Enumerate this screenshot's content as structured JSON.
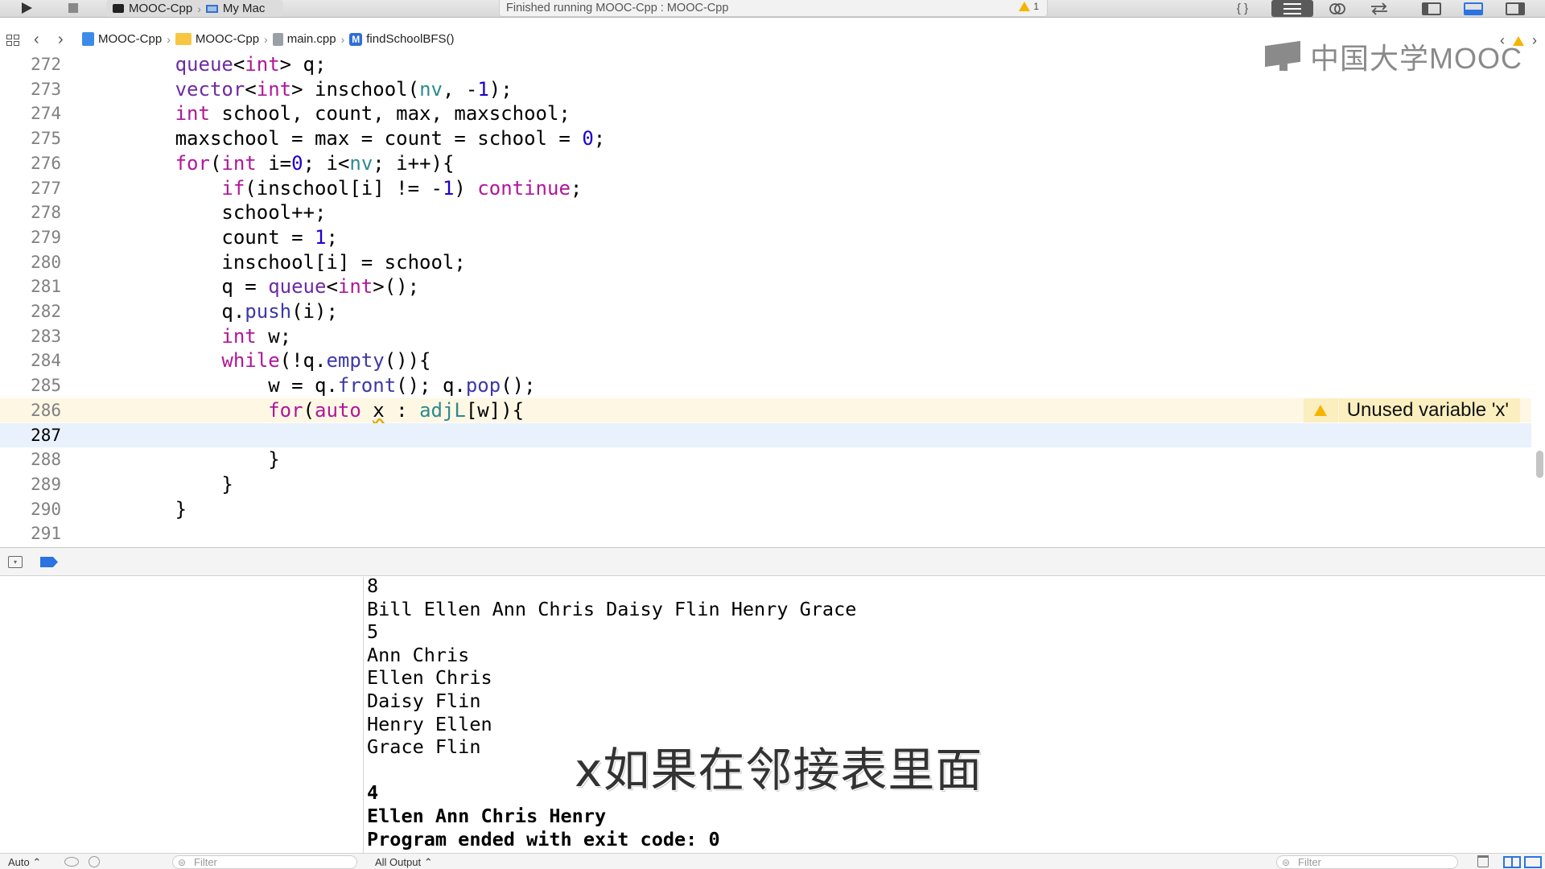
{
  "toolbar": {
    "scheme_name": "MOOC-Cpp",
    "destination": "My Mac",
    "status_text": "Finished running MOOC-Cpp : MOOC-Cpp",
    "warning_count": "1",
    "braces_label": "{ }",
    "icons": [
      "run-icon",
      "stop-icon",
      "terminal-icon",
      "mac-icon",
      "warning-icon",
      "standard-editor-icon",
      "assistant-editor-icon",
      "version-editor-icon",
      "navigator-toggle-icon",
      "debug-area-toggle-icon",
      "utilities-toggle-icon"
    ]
  },
  "jumpbar": {
    "crumbs": [
      "MOOC-Cpp",
      "MOOC-Cpp",
      "main.cpp",
      "findSchoolBFS()"
    ],
    "method_badge": "M",
    "back_label": "‹",
    "forward_label": "›"
  },
  "watermark": {
    "text": "中国大学MOOC"
  },
  "editor": {
    "current_line": 287,
    "warning": {
      "line": 286,
      "message": "Unused variable 'x'"
    },
    "lines": [
      {
        "n": "272",
        "html": "        <span class=\"ty\">queue</span>&lt;<span class=\"kw\">int</span>&gt; q;"
      },
      {
        "n": "273",
        "html": "        <span class=\"ty\">vector</span>&lt;<span class=\"kw\">int</span>&gt; inschool(<span class=\"vr\">nv</span>, -<span class=\"num\">1</span>);"
      },
      {
        "n": "274",
        "html": "        <span class=\"kw\">int</span> school, count, max, maxschool;"
      },
      {
        "n": "275",
        "html": "        maxschool = max = count = school = <span class=\"num\">0</span>;"
      },
      {
        "n": "276",
        "html": "        <span class=\"kw\">for</span>(<span class=\"kw\">int</span> i=<span class=\"num\">0</span>; i&lt;<span class=\"vr\">nv</span>; i++){"
      },
      {
        "n": "277",
        "html": "            <span class=\"kw\">if</span>(inschool[i] != -<span class=\"num\">1</span>) <span class=\"kw\">continue</span>;"
      },
      {
        "n": "278",
        "html": "            school++;"
      },
      {
        "n": "279",
        "html": "            count = <span class=\"num\">1</span>;"
      },
      {
        "n": "280",
        "html": "            inschool[i] = school;"
      },
      {
        "n": "281",
        "html": "            q = <span class=\"ty\">queue</span>&lt;<span class=\"kw\">int</span>&gt;();"
      },
      {
        "n": "282",
        "html": "            q.<span class=\"fn\">push</span>(i);"
      },
      {
        "n": "283",
        "html": "            <span class=\"kw\">int</span> w;"
      },
      {
        "n": "284",
        "html": "            <span class=\"kw\">while</span>(!q.<span class=\"fn\">empty</span>()){"
      },
      {
        "n": "285",
        "html": "                w = q.<span class=\"fn\">front</span>(); q.<span class=\"fn\">pop</span>();"
      },
      {
        "n": "286",
        "html": "                <span class=\"kw\">for</span>(<span class=\"kw\">auto</span> <span style=\"text-decoration: underline wavy #e0a800;\">x</span> : <span class=\"vr\">adjL</span>[w]){"
      },
      {
        "n": "287",
        "html": ""
      },
      {
        "n": "288",
        "html": "                }"
      },
      {
        "n": "289",
        "html": "            }"
      },
      {
        "n": "290",
        "html": "        }"
      },
      {
        "n": "291",
        "html": ""
      }
    ]
  },
  "console": {
    "lines": [
      {
        "text": "8",
        "bold": false
      },
      {
        "text": "Bill Ellen Ann Chris Daisy Flin Henry Grace",
        "bold": false
      },
      {
        "text": "5",
        "bold": false
      },
      {
        "text": "Ann Chris",
        "bold": false
      },
      {
        "text": "Ellen Chris",
        "bold": false
      },
      {
        "text": "Daisy Flin",
        "bold": false
      },
      {
        "text": "Henry Ellen",
        "bold": false
      },
      {
        "text": "Grace Flin",
        "bold": false
      },
      {
        "text": "",
        "bold": false
      },
      {
        "text": "4",
        "bold": true
      },
      {
        "text": "Ellen Ann Chris Henry",
        "bold": true
      },
      {
        "text": "Program ended with exit code: 0",
        "bold": true
      }
    ]
  },
  "subtitle": "x如果在邻接表里面",
  "footer": {
    "auto_label": "Auto ⌃",
    "filter_placeholder_left": "Filter",
    "output_selector": "All Output ⌃",
    "filter_placeholder_right": "Filter"
  }
}
